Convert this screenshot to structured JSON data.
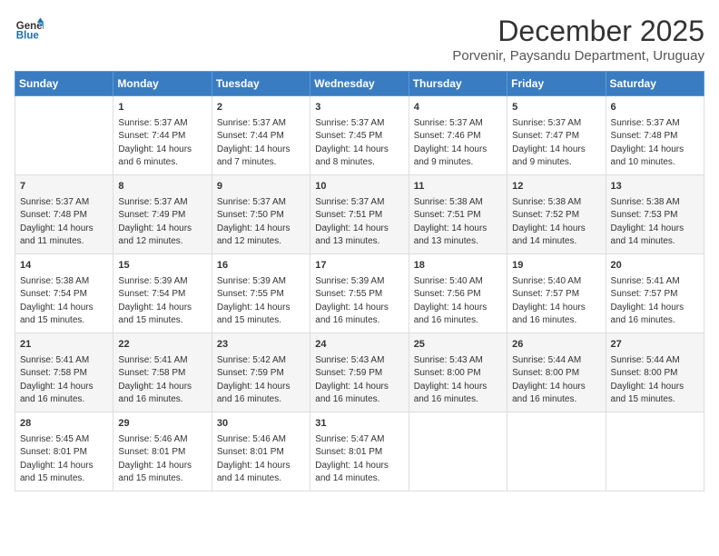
{
  "header": {
    "logo_line1": "General",
    "logo_line2": "Blue",
    "month": "December 2025",
    "location": "Porvenir, Paysandu Department, Uruguay"
  },
  "days_of_week": [
    "Sunday",
    "Monday",
    "Tuesday",
    "Wednesday",
    "Thursday",
    "Friday",
    "Saturday"
  ],
  "weeks": [
    [
      {
        "day": "",
        "info": ""
      },
      {
        "day": "1",
        "info": "Sunrise: 5:37 AM\nSunset: 7:44 PM\nDaylight: 14 hours\nand 6 minutes."
      },
      {
        "day": "2",
        "info": "Sunrise: 5:37 AM\nSunset: 7:44 PM\nDaylight: 14 hours\nand 7 minutes."
      },
      {
        "day": "3",
        "info": "Sunrise: 5:37 AM\nSunset: 7:45 PM\nDaylight: 14 hours\nand 8 minutes."
      },
      {
        "day": "4",
        "info": "Sunrise: 5:37 AM\nSunset: 7:46 PM\nDaylight: 14 hours\nand 9 minutes."
      },
      {
        "day": "5",
        "info": "Sunrise: 5:37 AM\nSunset: 7:47 PM\nDaylight: 14 hours\nand 9 minutes."
      },
      {
        "day": "6",
        "info": "Sunrise: 5:37 AM\nSunset: 7:48 PM\nDaylight: 14 hours\nand 10 minutes."
      }
    ],
    [
      {
        "day": "7",
        "info": "Sunrise: 5:37 AM\nSunset: 7:48 PM\nDaylight: 14 hours\nand 11 minutes."
      },
      {
        "day": "8",
        "info": "Sunrise: 5:37 AM\nSunset: 7:49 PM\nDaylight: 14 hours\nand 12 minutes."
      },
      {
        "day": "9",
        "info": "Sunrise: 5:37 AM\nSunset: 7:50 PM\nDaylight: 14 hours\nand 12 minutes."
      },
      {
        "day": "10",
        "info": "Sunrise: 5:37 AM\nSunset: 7:51 PM\nDaylight: 14 hours\nand 13 minutes."
      },
      {
        "day": "11",
        "info": "Sunrise: 5:38 AM\nSunset: 7:51 PM\nDaylight: 14 hours\nand 13 minutes."
      },
      {
        "day": "12",
        "info": "Sunrise: 5:38 AM\nSunset: 7:52 PM\nDaylight: 14 hours\nand 14 minutes."
      },
      {
        "day": "13",
        "info": "Sunrise: 5:38 AM\nSunset: 7:53 PM\nDaylight: 14 hours\nand 14 minutes."
      }
    ],
    [
      {
        "day": "14",
        "info": "Sunrise: 5:38 AM\nSunset: 7:54 PM\nDaylight: 14 hours\nand 15 minutes."
      },
      {
        "day": "15",
        "info": "Sunrise: 5:39 AM\nSunset: 7:54 PM\nDaylight: 14 hours\nand 15 minutes."
      },
      {
        "day": "16",
        "info": "Sunrise: 5:39 AM\nSunset: 7:55 PM\nDaylight: 14 hours\nand 15 minutes."
      },
      {
        "day": "17",
        "info": "Sunrise: 5:39 AM\nSunset: 7:55 PM\nDaylight: 14 hours\nand 16 minutes."
      },
      {
        "day": "18",
        "info": "Sunrise: 5:40 AM\nSunset: 7:56 PM\nDaylight: 14 hours\nand 16 minutes."
      },
      {
        "day": "19",
        "info": "Sunrise: 5:40 AM\nSunset: 7:57 PM\nDaylight: 14 hours\nand 16 minutes."
      },
      {
        "day": "20",
        "info": "Sunrise: 5:41 AM\nSunset: 7:57 PM\nDaylight: 14 hours\nand 16 minutes."
      }
    ],
    [
      {
        "day": "21",
        "info": "Sunrise: 5:41 AM\nSunset: 7:58 PM\nDaylight: 14 hours\nand 16 minutes."
      },
      {
        "day": "22",
        "info": "Sunrise: 5:41 AM\nSunset: 7:58 PM\nDaylight: 14 hours\nand 16 minutes."
      },
      {
        "day": "23",
        "info": "Sunrise: 5:42 AM\nSunset: 7:59 PM\nDaylight: 14 hours\nand 16 minutes."
      },
      {
        "day": "24",
        "info": "Sunrise: 5:43 AM\nSunset: 7:59 PM\nDaylight: 14 hours\nand 16 minutes."
      },
      {
        "day": "25",
        "info": "Sunrise: 5:43 AM\nSunset: 8:00 PM\nDaylight: 14 hours\nand 16 minutes."
      },
      {
        "day": "26",
        "info": "Sunrise: 5:44 AM\nSunset: 8:00 PM\nDaylight: 14 hours\nand 16 minutes."
      },
      {
        "day": "27",
        "info": "Sunrise: 5:44 AM\nSunset: 8:00 PM\nDaylight: 14 hours\nand 15 minutes."
      }
    ],
    [
      {
        "day": "28",
        "info": "Sunrise: 5:45 AM\nSunset: 8:01 PM\nDaylight: 14 hours\nand 15 minutes."
      },
      {
        "day": "29",
        "info": "Sunrise: 5:46 AM\nSunset: 8:01 PM\nDaylight: 14 hours\nand 15 minutes."
      },
      {
        "day": "30",
        "info": "Sunrise: 5:46 AM\nSunset: 8:01 PM\nDaylight: 14 hours\nand 14 minutes."
      },
      {
        "day": "31",
        "info": "Sunrise: 5:47 AM\nSunset: 8:01 PM\nDaylight: 14 hours\nand 14 minutes."
      },
      {
        "day": "",
        "info": ""
      },
      {
        "day": "",
        "info": ""
      },
      {
        "day": "",
        "info": ""
      }
    ]
  ]
}
